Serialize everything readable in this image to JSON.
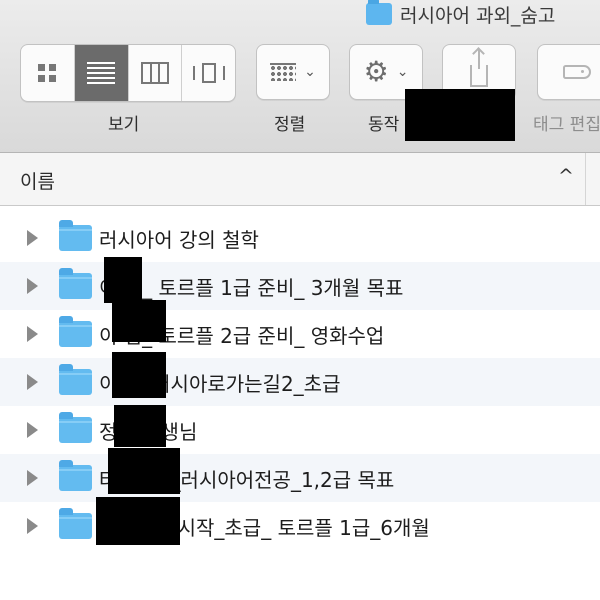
{
  "window": {
    "title": "러시아어 과외_숨고"
  },
  "toolbar": {
    "view_label": "보기",
    "arrange_label": "정렬",
    "action_label": "동작",
    "tags_label": "태그 편집",
    "view_modes": [
      {
        "name": "icon-view",
        "icon": "grid-icon",
        "active": false
      },
      {
        "name": "list-view",
        "icon": "list-icon",
        "active": true
      },
      {
        "name": "column-view",
        "icon": "columns-icon",
        "active": false
      },
      {
        "name": "cover-flow-view",
        "icon": "cover-flow-icon",
        "active": false
      }
    ],
    "action_icon": "gear-icon",
    "share_icon": "share-icon",
    "tag_icon": "tag-icon",
    "chevron": "⌄"
  },
  "header": {
    "name_column": "이름",
    "sort_indicator": "^"
  },
  "files": [
    {
      "name": "러시아어 강의 철학",
      "type": "folder"
    },
    {
      "name": "이 님_ 토르플 1급 준비_ 3개월 목표",
      "type": "folder"
    },
    {
      "name": "이 님_ 토르플 2급 준비_ 영화수업",
      "type": "folder"
    },
    {
      "name": "이 님_러시아로가는길2_초급",
      "type": "folder"
    },
    {
      "name": "정 수강생님",
      "type": "folder"
    },
    {
      "name": "타 _초급_러시아어전공_1,2급 목표",
      "type": "folder"
    },
    {
      "name": "_6월8일 시작_초급_ 토르플 1급_6개월",
      "type": "folder"
    }
  ],
  "colors": {
    "folder": "#63bbf0",
    "active_segment": "#6b6b6b",
    "toolbar_bg": "#d9d9d9",
    "alt_row": "#f3f6fa"
  }
}
